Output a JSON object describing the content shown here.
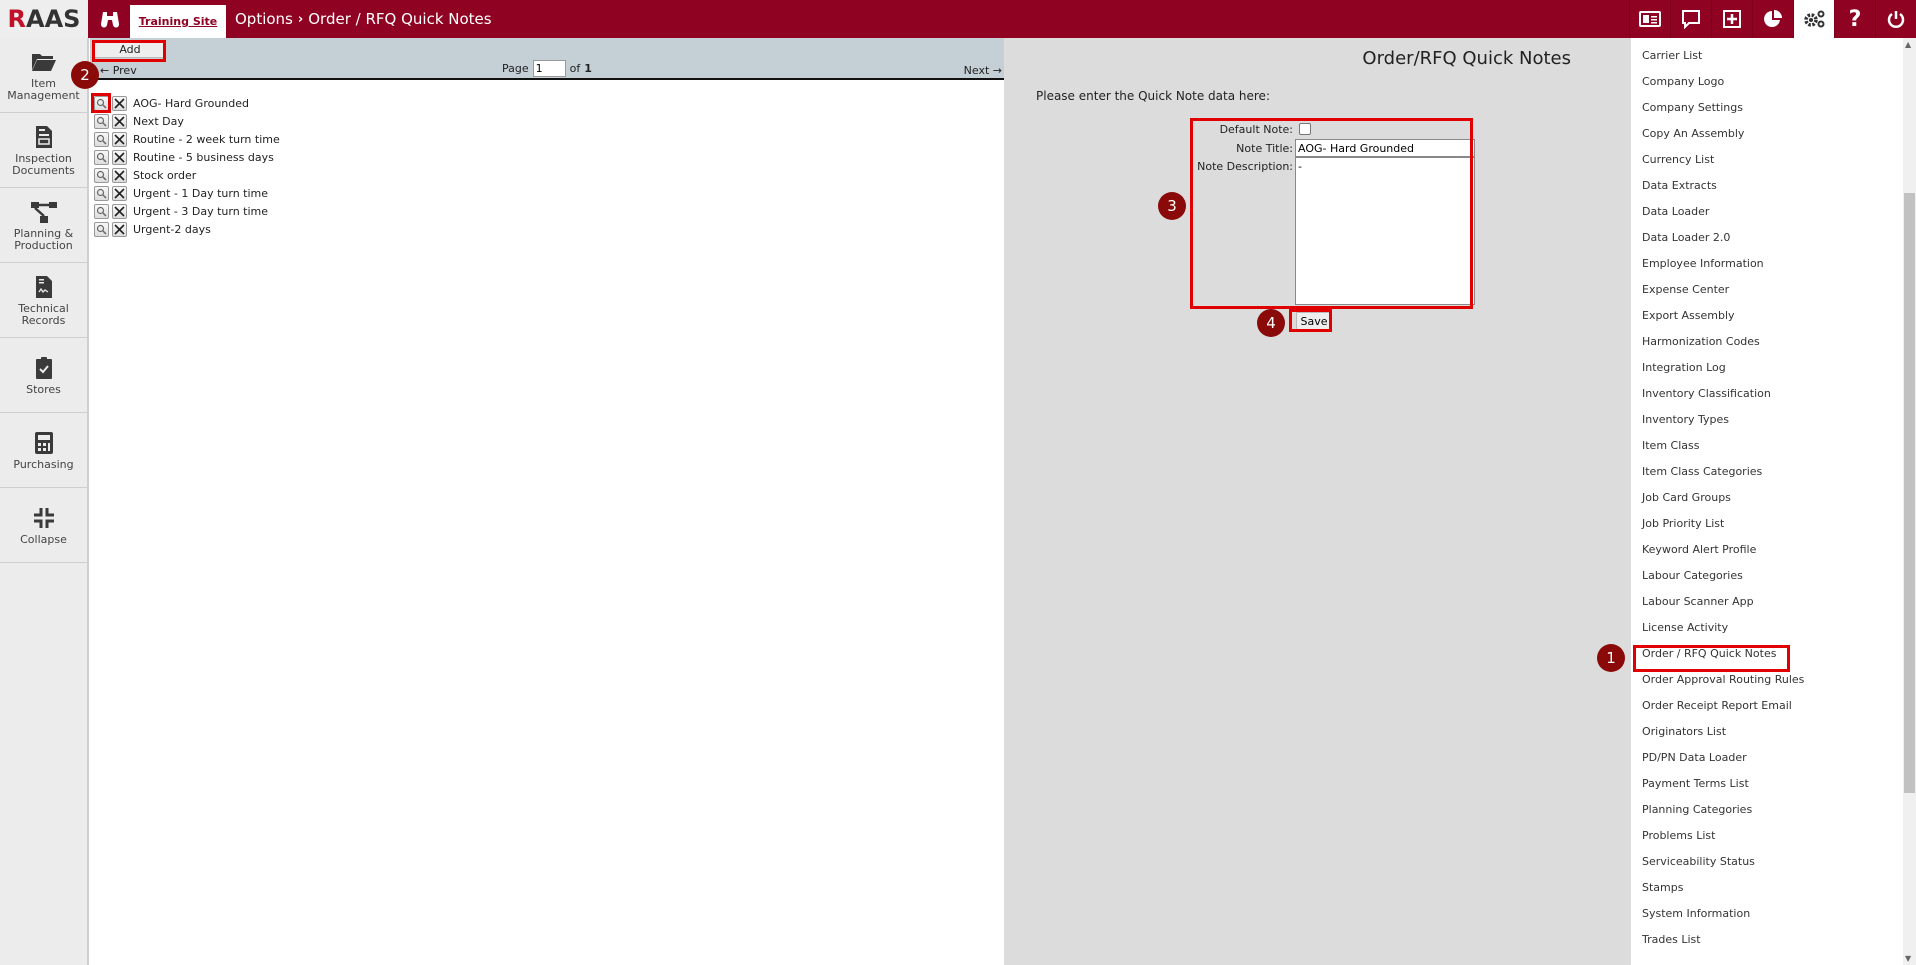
{
  "header": {
    "logo": "RAAS",
    "site_tab": "Training Site",
    "breadcrumb": [
      "Options",
      "Order / RFQ Quick Notes"
    ],
    "icons": [
      "contact-card-icon",
      "comment-icon",
      "plus-square-icon",
      "pie-chart-icon",
      "gears-icon",
      "help-icon",
      "power-icon"
    ],
    "active_icon": "gears-icon",
    "brand_color": "#8f0222"
  },
  "sidebar": {
    "items": [
      {
        "label": "Item Management",
        "icon": "folder-open-icon"
      },
      {
        "label": "Inspection Documents",
        "icon": "document-icon"
      },
      {
        "label": "Planning & Production",
        "icon": "flowchart-icon"
      },
      {
        "label": "Technical Records",
        "icon": "signature-file-icon"
      },
      {
        "label": "Stores",
        "icon": "clipboard-check-icon"
      },
      {
        "label": "Purchasing",
        "icon": "calculator-icon"
      },
      {
        "label": "Collapse",
        "icon": "compress-icon"
      }
    ]
  },
  "list": {
    "add_label": "Add",
    "prev_label": "← Prev",
    "page_label": "Page",
    "page_value": "1",
    "of_label": "of",
    "total_pages": "1",
    "next_label": "Next →",
    "notes": [
      "AOG- Hard Grounded",
      "Next Day",
      "Routine - 2 week turn time",
      "Routine - 5 business days",
      "Stock order",
      "Urgent - 1 Day turn time",
      "Urgent - 3 Day turn time",
      "Urgent-2 days"
    ]
  },
  "form": {
    "title": "Order/RFQ Quick Notes",
    "intro": "Please enter the Quick Note data here:",
    "default_note_label": "Default Note:",
    "default_note_checked": false,
    "note_title_label": "Note Title:",
    "note_title_value": "AOG- Hard Grounded",
    "note_description_label": "Note Description:",
    "note_description_value": "-",
    "save_label": "Save"
  },
  "options_menu": {
    "items": [
      "Carrier List",
      "Company Logo",
      "Company Settings",
      "Copy An Assembly",
      "Currency List",
      "Data Extracts",
      "Data Loader",
      "Data Loader 2.0",
      "Employee Information",
      "Expense Center",
      "Export Assembly",
      "Harmonization Codes",
      "Integration Log",
      "Inventory Classification",
      "Inventory Types",
      "Item Class",
      "Item Class Categories",
      "Job Card Groups",
      "Job Priority List",
      "Keyword Alert Profile",
      "Labour Categories",
      "Labour Scanner App",
      "License Activity",
      "Order / RFQ Quick Notes",
      "Order Approval Routing Rules",
      "Order Receipt Report Email",
      "Originators List",
      "PD/PN Data Loader",
      "Payment Terms List",
      "Planning Categories",
      "Problems List",
      "Serviceability Status",
      "Stamps",
      "System Information",
      "Trades List"
    ],
    "selected": "Order / RFQ Quick Notes"
  },
  "annotations": {
    "steps": [
      "1",
      "2",
      "3",
      "4"
    ],
    "highlight_color": "#e00000",
    "badge_color": "#8a0a0a"
  }
}
